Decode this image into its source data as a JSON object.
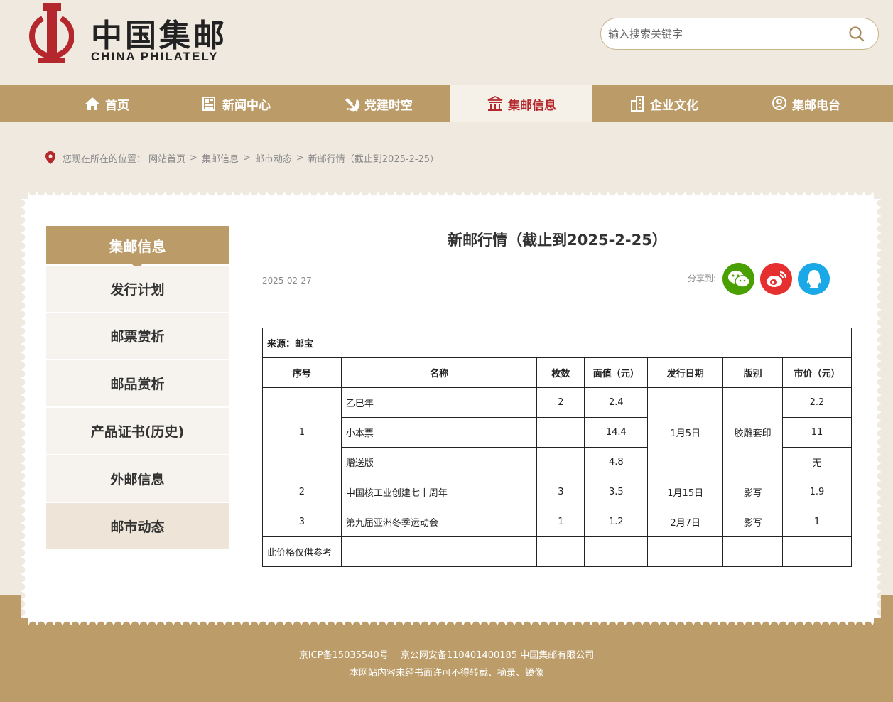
{
  "header": {
    "logo_cn": "中国集邮",
    "logo_en": "CHINA PHILATELY",
    "search_placeholder": "输入搜索关键字"
  },
  "nav": {
    "items": [
      {
        "label": "首页",
        "icon": "home-icon"
      },
      {
        "label": "新闻中心",
        "icon": "news-icon"
      },
      {
        "label": "党建时空",
        "icon": "party-icon"
      },
      {
        "label": "集邮信息",
        "icon": "museum-icon"
      },
      {
        "label": "企业文化",
        "icon": "building-icon"
      },
      {
        "label": "集邮电台",
        "icon": "radio-icon"
      }
    ],
    "active_index": 3
  },
  "breadcrumb": {
    "prefix": "您现在所在的位置：",
    "items": [
      "网站首页",
      "集邮信息",
      "邮市动态",
      "新邮行情（截止到2025-2-25）"
    ]
  },
  "sidebar": {
    "title": "集邮信息",
    "items": [
      "发行计划",
      "邮票赏析",
      "邮品赏析",
      "产品证书(历史)",
      "外邮信息",
      "邮市动态"
    ],
    "active_index": 5
  },
  "article": {
    "title": "新邮行情（截止到2025-2-25）",
    "date": "2025-02-27",
    "share_label": "分享到:",
    "share_buttons": [
      {
        "icon": "wechat-icon",
        "color": "#4aa000"
      },
      {
        "icon": "weibo-icon",
        "color": "#e6302f"
      },
      {
        "icon": "qq-icon",
        "color": "#1ba8e6"
      }
    ]
  },
  "table": {
    "source": "来源：邮宝",
    "headers": [
      "序号",
      "名称",
      "枚数",
      "面值（元）",
      "发行日期",
      "版别",
      "市价（元）"
    ],
    "group1": {
      "no": "1",
      "date": "1月5日",
      "edition": "胶雕套印",
      "rows": [
        {
          "name": "乙巳年",
          "count": "2",
          "face": "2.4",
          "price": "2.2"
        },
        {
          "name": "小本票",
          "count": "",
          "face": "14.4",
          "price": "11"
        },
        {
          "name": "赠送版",
          "count": "",
          "face": "4.8",
          "price": "无"
        }
      ]
    },
    "rows": [
      {
        "no": "2",
        "name": "中国核工业创建七十周年",
        "count": "3",
        "face": "3.5",
        "date": "1月15日",
        "edition": "影写",
        "price": "1.9"
      },
      {
        "no": "3",
        "name": "第九届亚洲冬季运动会",
        "count": "1",
        "face": "1.2",
        "date": "2月7日",
        "edition": "影写",
        "price": "1"
      }
    ],
    "note": "此价格仅供参考"
  },
  "footer": {
    "line1": "京ICP备15035540号　 京公网安备110401400185 中国集邮有限公司",
    "line2": "本网站内容未经书面许可不得转载、摘录、镜像"
  },
  "colors": {
    "brand_gold": "#bb9c68",
    "brand_red": "#b4282d",
    "page_bg": "#efe9e0"
  }
}
